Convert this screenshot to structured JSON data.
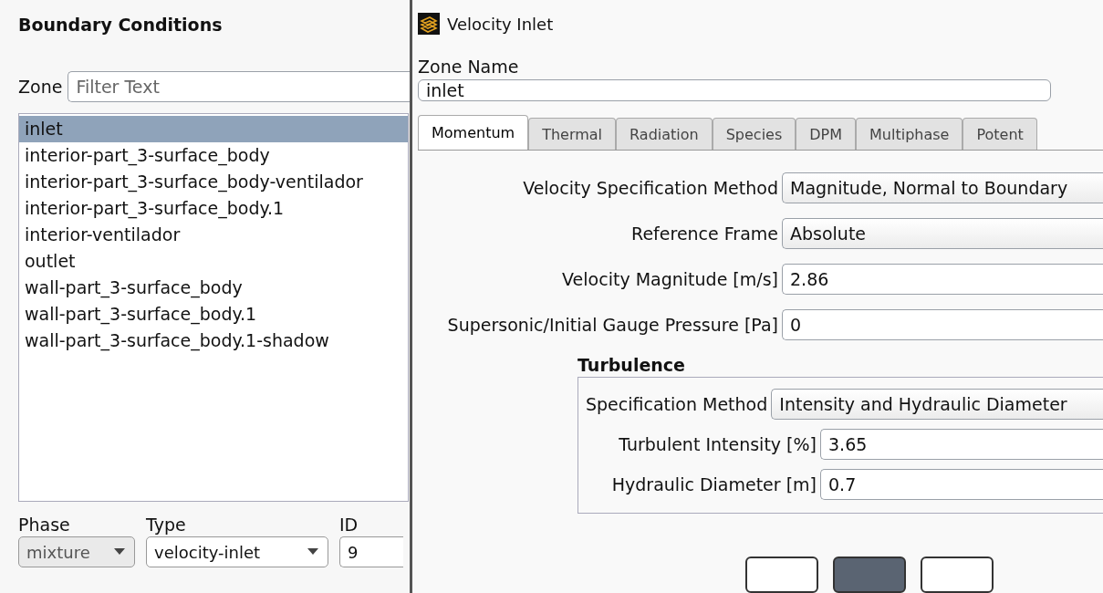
{
  "boundary_conditions": {
    "title": "Boundary Conditions",
    "zone": {
      "label": "Zone",
      "placeholder": "Filter Text"
    },
    "zones": [
      {
        "label": "inlet",
        "selected": true
      },
      {
        "label": "interior-part_3-surface_body",
        "selected": false
      },
      {
        "label": "interior-part_3-surface_body-ventilador",
        "selected": false
      },
      {
        "label": "interior-part_3-surface_body.1",
        "selected": false
      },
      {
        "label": "interior-ventilador",
        "selected": false
      },
      {
        "label": "outlet",
        "selected": false
      },
      {
        "label": "wall-part_3-surface_body",
        "selected": false
      },
      {
        "label": "wall-part_3-surface_body.1",
        "selected": false
      },
      {
        "label": "wall-part_3-surface_body.1-shadow",
        "selected": false
      }
    ],
    "phase": {
      "label": "Phase",
      "value": "mixture",
      "disabled": true
    },
    "type": {
      "label": "Type",
      "value": "velocity-inlet",
      "disabled": false
    },
    "id": {
      "label": "ID",
      "value": "9"
    }
  },
  "dialog": {
    "title": "Velocity Inlet",
    "zone_name": {
      "label": "Zone Name",
      "value": "inlet"
    },
    "tabs": [
      {
        "label": "Momentum",
        "selected": true
      },
      {
        "label": "Thermal",
        "selected": false
      },
      {
        "label": "Radiation",
        "selected": false
      },
      {
        "label": "Species",
        "selected": false
      },
      {
        "label": "DPM",
        "selected": false
      },
      {
        "label": "Multiphase",
        "selected": false
      },
      {
        "label": "Potent",
        "selected": false
      }
    ],
    "fields": [
      {
        "label": "Velocity Specification Method",
        "value": "Magnitude, Normal to Boundary",
        "kind": "dropdown"
      },
      {
        "label": "Reference Frame",
        "value": "Absolute",
        "kind": "dropdown"
      },
      {
        "label": "Velocity Magnitude [m/s]",
        "value": "2.86",
        "kind": "input"
      },
      {
        "label": "Supersonic/Initial Gauge Pressure [Pa]",
        "value": "0",
        "kind": "input"
      }
    ],
    "turbulence": {
      "title": "Turbulence",
      "method": {
        "label": "Specification Method",
        "value": "Intensity and Hydraulic Diameter",
        "kind": "dropdown"
      },
      "fields": [
        {
          "label": "Turbulent Intensity [%]",
          "value": "3.65",
          "kind": "input"
        },
        {
          "label": "Hydraulic Diameter [m]",
          "value": "0.7",
          "kind": "input"
        }
      ]
    },
    "buttons": [
      {
        "default": false
      },
      {
        "default": true
      },
      {
        "default": false
      }
    ]
  }
}
